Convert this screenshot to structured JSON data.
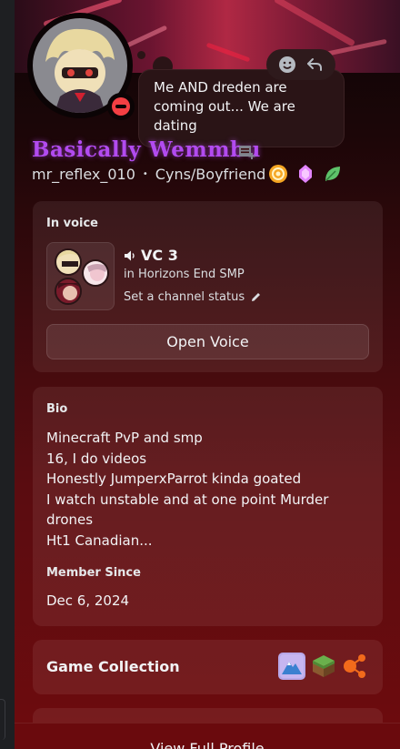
{
  "custom_status": {
    "text": "Me AND dreden are coming out... We are dating"
  },
  "profile": {
    "display_name": "Basically Wemmbu",
    "username": "mr_reflex_010",
    "separator": "•",
    "pronouns": "Cyns/Boyfriend"
  },
  "voice": {
    "section_label": "In voice",
    "channel_name": "VC 3",
    "server": "in Horizons End SMP",
    "status_prompt": "Set a channel status",
    "open_button": "Open Voice"
  },
  "bio": {
    "section_label": "Bio",
    "lines": [
      "Minecraft PvP and smp",
      "16, I do videos",
      "Honestly JumperxParrot kinda goated",
      "I watch unstable and at one point Murder drones",
      "Ht1 Canadian..."
    ],
    "member_label": "Member Since",
    "member_date": "Dec 6, 2024"
  },
  "games": {
    "section_label": "Game Collection",
    "icons": [
      "mountain-game-icon",
      "minecraft-grass-block-icon",
      "orange-nodes-game-icon"
    ]
  },
  "footer": {
    "view_full_profile": "View Full Profile"
  },
  "colors": {
    "display_name": "#b24bf0",
    "dnd_status": "#f23f43"
  }
}
